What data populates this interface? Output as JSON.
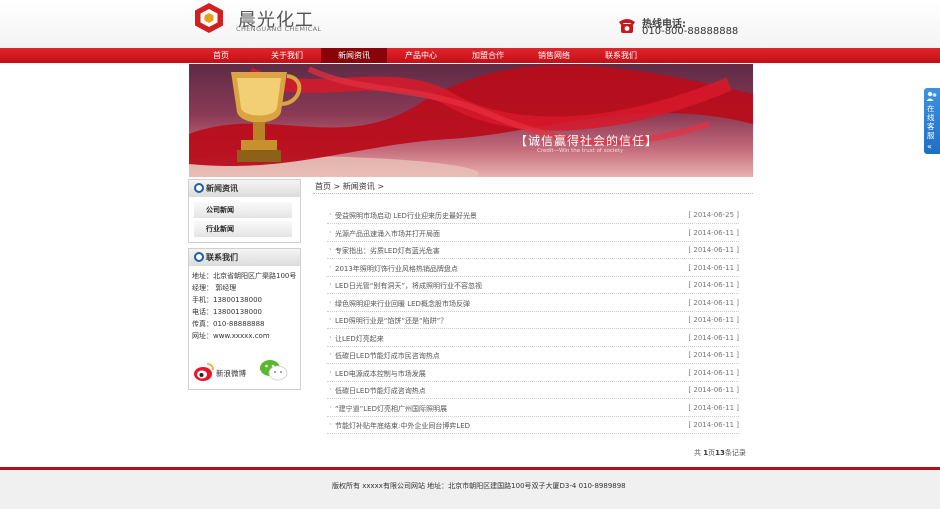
{
  "header": {
    "logo_cn": "晨光化工",
    "logo_en": "CHENGUANG CHEMICAL",
    "hotline_label": "热线电话:",
    "hotline_number": "010-800-88888888"
  },
  "nav": {
    "items": [
      {
        "label": "首页"
      },
      {
        "label": "关于我们"
      },
      {
        "label": "新闻资讯",
        "active": true
      },
      {
        "label": "产品中心"
      },
      {
        "label": "加盟合作"
      },
      {
        "label": "销售网络"
      },
      {
        "label": "联系我们"
      }
    ]
  },
  "banner": {
    "slogan": "【诚信赢得社会的信任】",
    "subtitle": "Credit—Win the trust of society"
  },
  "sidebar": {
    "news_title": "新闻资讯",
    "news_links": [
      "公司新闻",
      "行业新闻"
    ],
    "contact_title": "联系我们",
    "contact_lines": [
      "地址：北京省朝阳区广渠路100号",
      "经理： 郭经理",
      "手机：13800138000",
      "电话：13800138000",
      "传真：010-88888888",
      "网址：www.xxxxx.com"
    ],
    "weibo_label": "新浪微博"
  },
  "breadcrumb": {
    "home": "首页",
    "sep1": ">",
    "current": "新闻资讯",
    "sep2": ">"
  },
  "news": [
    {
      "title": "受益照明市场启动 LED行业迎来历史最好光景",
      "date": "[ 2014-06-25 ]"
    },
    {
      "title": "光源产品迅速涌入市场并打开局面",
      "date": "[ 2014-06-11 ]"
    },
    {
      "title": "专家指出：劣质LED灯有蓝光危害",
      "date": "[ 2014-06-11 ]"
    },
    {
      "title": "2013年照明灯饰行业风格热销品牌盘点",
      "date": "[ 2014-06-11 ]"
    },
    {
      "title": "LED日光管“别有洞天”，将成照明行业不容忽视",
      "date": "[ 2014-06-11 ]"
    },
    {
      "title": "绿色照明迎来行业回暖 LED概念股市场反弹",
      "date": "[ 2014-06-11 ]"
    },
    {
      "title": "LED照明行业是“馅饼”还是“陷阱”？",
      "date": "[ 2014-06-11 ]"
    },
    {
      "title": "让LED灯亮起来",
      "date": "[ 2014-06-11 ]"
    },
    {
      "title": "低碳日LED节能灯成市民咨询热点",
      "date": "[ 2014-06-11 ]"
    },
    {
      "title": "LED电源成本控制与市场发展",
      "date": "[ 2014-06-11 ]"
    },
    {
      "title": "低碳日LED节能灯成咨询热点",
      "date": "[ 2014-06-11 ]"
    },
    {
      "title": "“建宁道”LED灯亮相广州国际照明展",
      "date": "[ 2014-06-11 ]"
    },
    {
      "title": "节能灯补贴年底结束:中外企业同台博弈LED",
      "date": "[ 2014-06-11 ]"
    }
  ],
  "pager": {
    "prefix": "共",
    "pages": "1",
    "mid": "页",
    "count": "13",
    "suffix": "条记录"
  },
  "footer": {
    "text": "版权所有 xxxxx有限公司网站 地址：北京市朝阳区建国路100号双子大厦D3-4 010-8989898"
  },
  "float_service": {
    "label": "在线客服"
  },
  "colors": {
    "brand_red": "#c40f16",
    "nav_active": "#8a0309",
    "accent_blue": "#1f6fc4"
  }
}
